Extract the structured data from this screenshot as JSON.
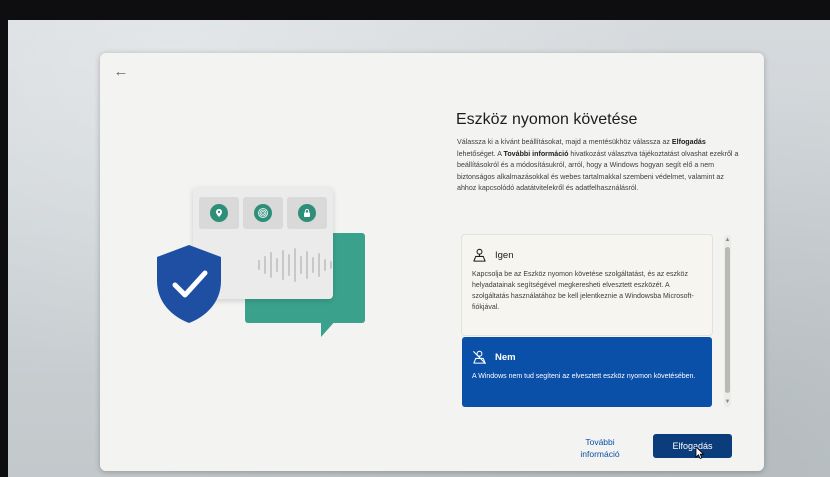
{
  "dialog": {
    "back_icon": "arrow-left-icon",
    "title": "Eszköz nyomon követése",
    "description": {
      "part1": "Válassza ki a kívánt beállításokat, majd a mentésükhöz válassza az ",
      "bold1": "Elfogadás",
      "part2": " lehetőséget. A ",
      "bold2": "További információ",
      "part3": " hivatkozást választva tájékoztatást olvashat ezekről a beállításokról és a módosításukról, arról, hogy a Windows hogyan segít elő a nem biztonságos alkalmazásokkal és webes tartalmakkal szembeni védelmet, valamint az ahhoz kapcsolódó adatátvitelekről és adatfelhasználásról."
    },
    "options": [
      {
        "label": "Igen",
        "icon": "location-person-icon",
        "text": "Kapcsolja be az Eszköz nyomon követése szolgáltatást, és az eszköz helyadatainak segítségével megkeresheti elvesztett eszközét. A szolgáltatás használatához be kell jelentkeznie a Windowsba Microsoft-fiókjával.",
        "selected": false
      },
      {
        "label": "Nem",
        "icon": "location-off-icon",
        "text": "A Windows nem tud segíteni az elvesztett eszköz nyomon követésében.",
        "selected": true
      }
    ],
    "more_info_label": "További információ",
    "accept_label": "Elfogadás"
  },
  "illustration": {
    "icons": [
      "location-pin-icon",
      "fingerprint-icon",
      "lock-icon"
    ],
    "shield_icon": "shield-check-icon"
  },
  "colors": {
    "accent": "#0a4fa8",
    "button": "#0b3d7c",
    "teal": "#3aa28c",
    "shield": "#1e4fa3"
  }
}
